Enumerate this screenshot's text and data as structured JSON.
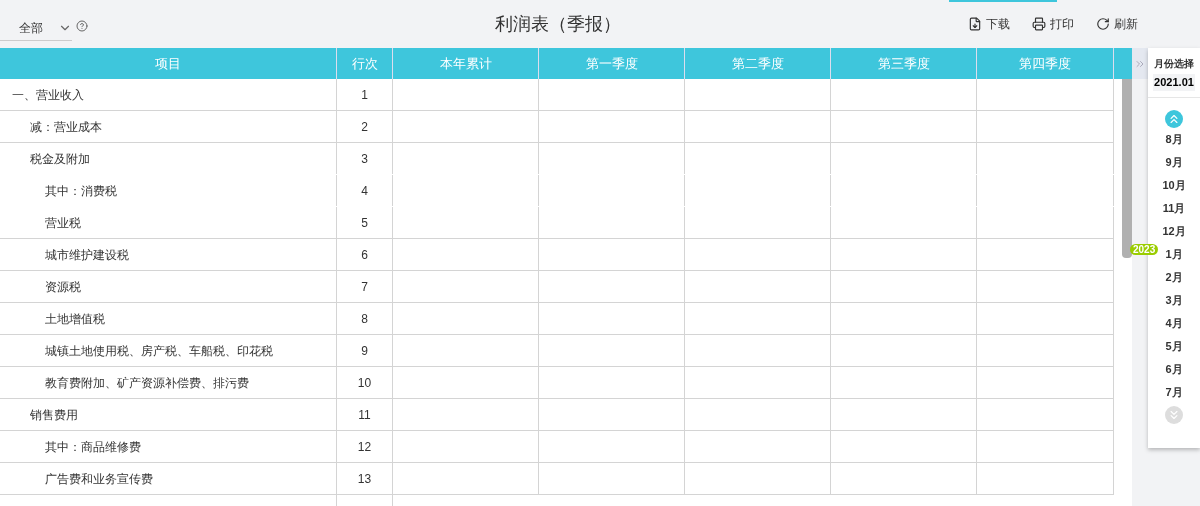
{
  "filter": {
    "value": "全部"
  },
  "title": "利润表（季报）",
  "actions": [
    {
      "kind": "download",
      "label": "下载"
    },
    {
      "kind": "print",
      "label": "打印"
    },
    {
      "kind": "refresh",
      "label": "刷新"
    }
  ],
  "table": {
    "columns": [
      "项目",
      "行次",
      "本年累计",
      "第一季度",
      "第二季度",
      "第三季度",
      "第四季度"
    ],
    "rows": [
      {
        "item": "一、营业收入",
        "line": "1",
        "bottom_rule": true,
        "children": [
          {
            "item": "减：营业成本",
            "line": "2",
            "bottom_rule": true
          },
          {
            "item": "税金及附加",
            "line": "3",
            "bottom_rule": false,
            "children": [
              {
                "item": "其中：消费税",
                "line": "4",
                "bottom_rule": false
              },
              {
                "item": "营业税",
                "line": "5",
                "bottom_rule": true
              },
              {
                "item": "城市维护建设税",
                "line": "6",
                "bottom_rule": true
              },
              {
                "item": "资源税",
                "line": "7",
                "bottom_rule": true
              },
              {
                "item": "土地增值税",
                "line": "8",
                "bottom_rule": true
              },
              {
                "item": "城镇土地使用税、房产税、车船税、印花税",
                "line": "9",
                "bottom_rule": true
              },
              {
                "item": "教育费附加、矿产资源补偿费、排污费",
                "line": "10",
                "bottom_rule": true
              }
            ]
          },
          {
            "item": "销售费用",
            "line": "11",
            "bottom_rule": true,
            "children": [
              {
                "item": "其中：商品维修费",
                "line": "12",
                "bottom_rule": true
              },
              {
                "item": "广告费和业务宣传费",
                "line": "13",
                "bottom_rule": true
              }
            ]
          }
        ]
      }
    ]
  },
  "month_picker": {
    "title": "月份选择",
    "current": "2021.01",
    "items": [
      {
        "kind": "month",
        "label": "8月"
      },
      {
        "kind": "month",
        "label": "9月"
      },
      {
        "kind": "month",
        "label": "10月"
      },
      {
        "kind": "month",
        "label": "11月"
      },
      {
        "kind": "month",
        "label": "12月"
      },
      {
        "kind": "year",
        "label": "2023"
      },
      {
        "kind": "month",
        "label": "1月"
      },
      {
        "kind": "month",
        "label": "2月"
      },
      {
        "kind": "month",
        "label": "3月"
      },
      {
        "kind": "month",
        "label": "4月"
      },
      {
        "kind": "month",
        "label": "5月"
      },
      {
        "kind": "month",
        "label": "6月"
      },
      {
        "kind": "month",
        "label": "7月"
      }
    ]
  }
}
